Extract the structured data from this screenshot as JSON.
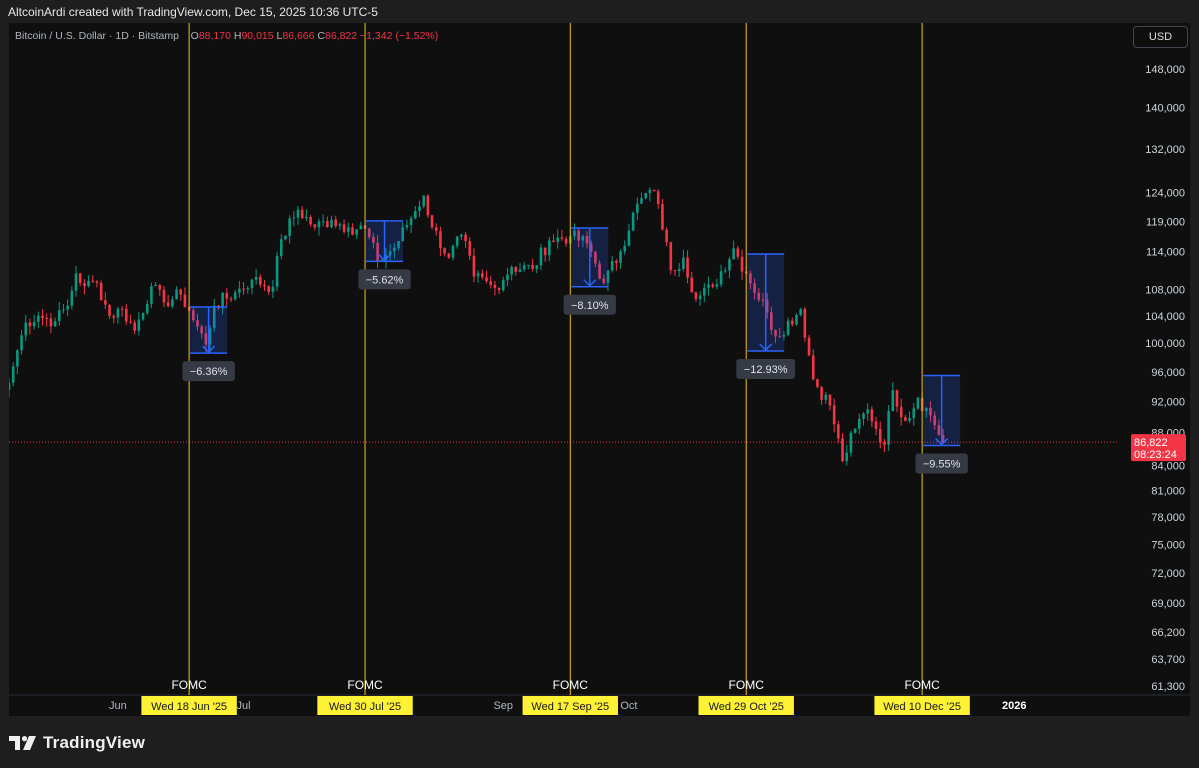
{
  "header": {
    "attribution": "AltcoinArdi created with TradingView.com, Dec 15, 2025 10:36 UTC-5"
  },
  "symbol": {
    "name": "Bitcoin / U.S. Dollar · 1D · Bitstamp",
    "open_label": "O",
    "open": "88,170",
    "high_label": "H",
    "high": "90,015",
    "low_label": "L",
    "low": "86,666",
    "close_label": "C",
    "close": "86,822",
    "change": "−1,342 (−1.52%)"
  },
  "currency_button": "USD",
  "logo": {
    "text": "TradingView"
  },
  "colors": {
    "up": "#089981",
    "down": "#f23645",
    "fomc_line": "#f0c419",
    "fomc_label_bg": "#fff133",
    "drop_box": "#2962ff",
    "background": "#0f0f0f"
  },
  "chart_data": {
    "type": "candlestick",
    "title": "Bitcoin / U.S. Dollar · 1D · Bitstamp",
    "y_scale": "log",
    "ylim": [
      60500,
      158000
    ],
    "y_ticks": [
      148000,
      140000,
      132000,
      124000,
      119000,
      114000,
      108000,
      104000,
      100000,
      96000,
      92000,
      88000,
      84000,
      81000,
      78000,
      75000,
      72000,
      69000,
      66200,
      63700,
      61300
    ],
    "y_tick_labels": [
      "148,000",
      "140,000",
      "132,000",
      "124,000",
      "119,000",
      "114,000",
      "108,000",
      "104,000",
      "100,000",
      "96,000",
      "92,000",
      "88,000",
      "84,000",
      "81,000",
      "78,000",
      "75,000",
      "72,000",
      "69,000",
      "66,200",
      "63,700",
      "61,300"
    ],
    "x_range": [
      "2025-05-06",
      "2026-01-26"
    ],
    "x_ticks": [
      {
        "date": "2025-06-01",
        "label": "Jun"
      },
      {
        "date": "2025-07-01",
        "label": "Jul"
      },
      {
        "date": "2025-09-01",
        "label": "Sep"
      },
      {
        "date": "2025-10-01",
        "label": "Oct"
      },
      {
        "date": "2026-01-01",
        "label": "2026"
      }
    ],
    "current_price": {
      "value": 86822,
      "label": "86,822",
      "countdown": "08:23:24"
    },
    "fomc_events": [
      {
        "date": "2025-06-18",
        "label": "FOMC",
        "date_label": "Wed 18 Jun '25",
        "drop_pct": "−6.36%",
        "from": 105300,
        "to": 98600
      },
      {
        "date": "2025-07-30",
        "label": "FOMC",
        "date_label": "Wed 30 Jul '25",
        "drop_pct": "−5.62%",
        "from": 119100,
        "to": 112400
      },
      {
        "date": "2025-09-17",
        "label": "FOMC",
        "date_label": "Wed 17 Sep '25",
        "drop_pct": "−8.10%",
        "from": 117900,
        "to": 108400
      },
      {
        "date": "2025-10-29",
        "label": "FOMC",
        "date_label": "Wed 29 Oct '25",
        "drop_pct": "−12.93%",
        "from": 113600,
        "to": 98900
      },
      {
        "date": "2025-12-10",
        "label": "FOMC",
        "date_label": "Wed 10 Dec '25",
        "drop_pct": "−9.55%",
        "from": 95500,
        "to": 86400
      }
    ],
    "series": [
      {
        "name": "BTCUSD",
        "waypoints": [
          [
            "2025-05-06",
            94500
          ],
          [
            "2025-05-08",
            99000
          ],
          [
            "2025-05-10",
            103000
          ],
          [
            "2025-05-13",
            104000
          ],
          [
            "2025-05-17",
            103200
          ],
          [
            "2025-05-20",
            105500
          ],
          [
            "2025-05-22",
            110500
          ],
          [
            "2025-05-24",
            108500
          ],
          [
            "2025-05-27",
            109000
          ],
          [
            "2025-05-30",
            104000
          ],
          [
            "2025-06-02",
            105000
          ],
          [
            "2025-06-05",
            101800
          ],
          [
            "2025-06-09",
            108500
          ],
          [
            "2025-06-12",
            106000
          ],
          [
            "2025-06-16",
            107200
          ],
          [
            "2025-06-18",
            104800
          ],
          [
            "2025-06-22",
            99800
          ],
          [
            "2025-06-24",
            105500
          ],
          [
            "2025-06-29",
            107500
          ],
          [
            "2025-07-03",
            109500
          ],
          [
            "2025-07-08",
            108400
          ],
          [
            "2025-07-10",
            116000
          ],
          [
            "2025-07-14",
            121000
          ],
          [
            "2025-07-18",
            118000
          ],
          [
            "2025-07-22",
            119300
          ],
          [
            "2025-07-26",
            118000
          ],
          [
            "2025-07-30",
            117800
          ],
          [
            "2025-08-02",
            112500
          ],
          [
            "2025-08-06",
            114600
          ],
          [
            "2025-08-09",
            118400
          ],
          [
            "2025-08-13",
            123500
          ],
          [
            "2025-08-15",
            118000
          ],
          [
            "2025-08-19",
            113000
          ],
          [
            "2025-08-22",
            116800
          ],
          [
            "2025-08-25",
            110000
          ],
          [
            "2025-08-30",
            108200
          ],
          [
            "2025-09-03",
            111500
          ],
          [
            "2025-09-08",
            111200
          ],
          [
            "2025-09-12",
            115800
          ],
          [
            "2025-09-17",
            116500
          ],
          [
            "2025-09-21",
            115300
          ],
          [
            "2025-09-25",
            109000
          ],
          [
            "2025-09-29",
            114000
          ],
          [
            "2025-10-02",
            120500
          ],
          [
            "2025-10-06",
            124500
          ],
          [
            "2025-10-08",
            122000
          ],
          [
            "2025-10-11",
            111000
          ],
          [
            "2025-10-14",
            113000
          ],
          [
            "2025-10-17",
            106500
          ],
          [
            "2025-10-21",
            108400
          ],
          [
            "2025-10-26",
            114500
          ],
          [
            "2025-10-29",
            110500
          ],
          [
            "2025-11-03",
            104500
          ],
          [
            "2025-11-05",
            101000
          ],
          [
            "2025-11-11",
            105000
          ],
          [
            "2025-11-14",
            95000
          ],
          [
            "2025-11-18",
            91500
          ],
          [
            "2025-11-21",
            84500
          ],
          [
            "2025-11-24",
            88500
          ],
          [
            "2025-11-27",
            91000
          ],
          [
            "2025-12-01",
            86500
          ],
          [
            "2025-12-03",
            93500
          ],
          [
            "2025-12-06",
            89500
          ],
          [
            "2025-12-09",
            92500
          ],
          [
            "2025-12-12",
            90200
          ],
          [
            "2025-12-15",
            86822
          ]
        ]
      }
    ]
  }
}
